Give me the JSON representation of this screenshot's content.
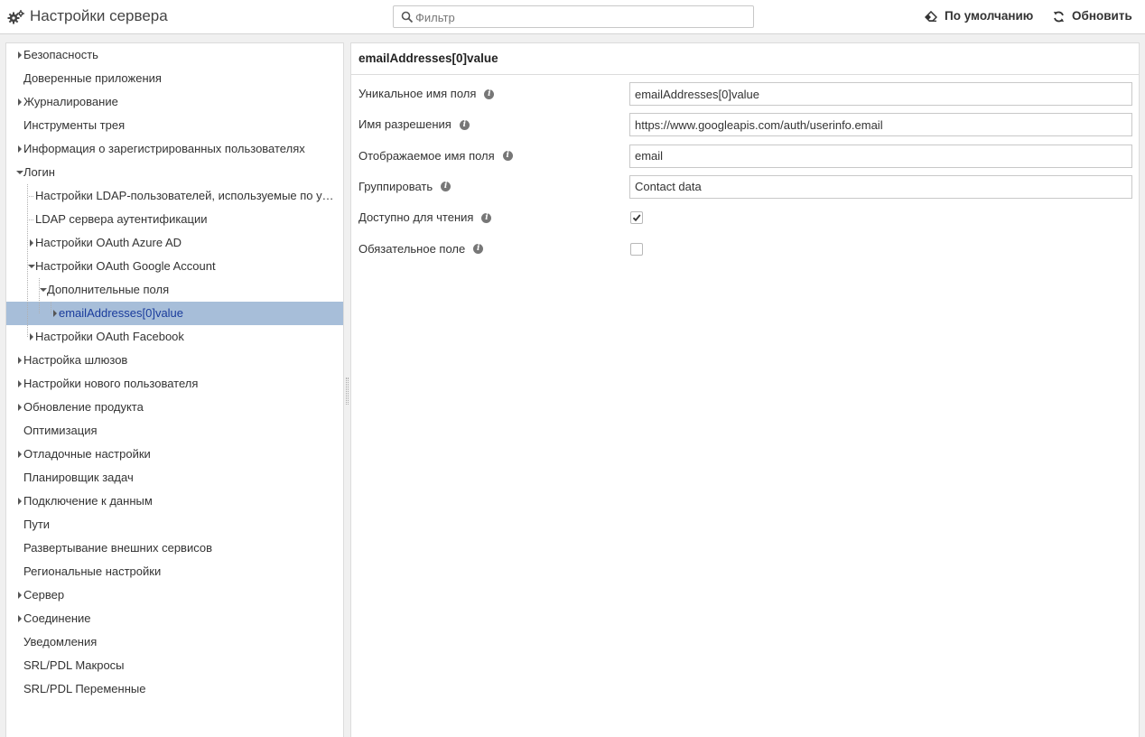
{
  "header": {
    "title": "Настройки сервера",
    "filter_placeholder": "Фильтр",
    "default_label": "По умолчанию",
    "refresh_label": "Обновить"
  },
  "tree": [
    {
      "label": "Безопасность",
      "level": 0,
      "expander": "collapsed"
    },
    {
      "label": "Доверенные приложения",
      "level": 0,
      "expander": "none"
    },
    {
      "label": "Журналирование",
      "level": 0,
      "expander": "collapsed"
    },
    {
      "label": "Инструменты трея",
      "level": 0,
      "expander": "none"
    },
    {
      "label": "Информация о зарегистрированных пользователях",
      "level": 0,
      "expander": "collapsed"
    },
    {
      "label": "Логин",
      "level": 0,
      "expander": "expanded"
    },
    {
      "label": "Настройки LDAP-пользователей, используемые по умолчанию",
      "level": 1,
      "expander": "none"
    },
    {
      "label": "LDAP сервера аутентификации",
      "level": 1,
      "expander": "none"
    },
    {
      "label": "Настройки OAuth Azure AD",
      "level": 1,
      "expander": "collapsed"
    },
    {
      "label": "Настройки OAuth Google Account",
      "level": 1,
      "expander": "expanded"
    },
    {
      "label": "Дополнительные поля",
      "level": 2,
      "expander": "expanded"
    },
    {
      "label": "emailAddresses[0]value",
      "level": 3,
      "expander": "collapsed",
      "selected": true
    },
    {
      "label": "Настройки OAuth Facebook",
      "level": 1,
      "expander": "collapsed"
    },
    {
      "label": "Настройка шлюзов",
      "level": 0,
      "expander": "collapsed"
    },
    {
      "label": "Настройки нового пользователя",
      "level": 0,
      "expander": "collapsed"
    },
    {
      "label": "Обновление продукта",
      "level": 0,
      "expander": "collapsed"
    },
    {
      "label": "Оптимизация",
      "level": 0,
      "expander": "none"
    },
    {
      "label": "Отладочные настройки",
      "level": 0,
      "expander": "collapsed"
    },
    {
      "label": "Планировщик задач",
      "level": 0,
      "expander": "none"
    },
    {
      "label": "Подключение к данным",
      "level": 0,
      "expander": "collapsed"
    },
    {
      "label": "Пути",
      "level": 0,
      "expander": "none"
    },
    {
      "label": "Развертывание внешних сервисов",
      "level": 0,
      "expander": "none"
    },
    {
      "label": "Региональные настройки",
      "level": 0,
      "expander": "none"
    },
    {
      "label": "Сервер",
      "level": 0,
      "expander": "collapsed"
    },
    {
      "label": "Соединение",
      "level": 0,
      "expander": "collapsed"
    },
    {
      "label": "Уведомления",
      "level": 0,
      "expander": "none"
    },
    {
      "label": "SRL/PDL Макросы",
      "level": 0,
      "expander": "none"
    },
    {
      "label": "SRL/PDL Переменные",
      "level": 0,
      "expander": "none"
    }
  ],
  "detail": {
    "title": "emailAddresses[0]value",
    "fields": [
      {
        "label": "Уникальное имя поля",
        "type": "text",
        "value": "emailAddresses[0]value"
      },
      {
        "label": "Имя разрешения",
        "type": "text",
        "value": "https://www.googleapis.com/auth/userinfo.email"
      },
      {
        "label": "Отображаемое имя поля",
        "type": "text",
        "value": "email"
      },
      {
        "label": "Группировать",
        "type": "text",
        "value": "Contact data"
      },
      {
        "label": "Доступно для чтения",
        "type": "checkbox",
        "checked": true
      },
      {
        "label": "Обязательное поле",
        "type": "checkbox",
        "checked": false
      }
    ]
  },
  "colors": {
    "selected_row_bg": "#a7bed9",
    "selected_row_text": "#1a3c9c",
    "info_icon": "#777777"
  }
}
